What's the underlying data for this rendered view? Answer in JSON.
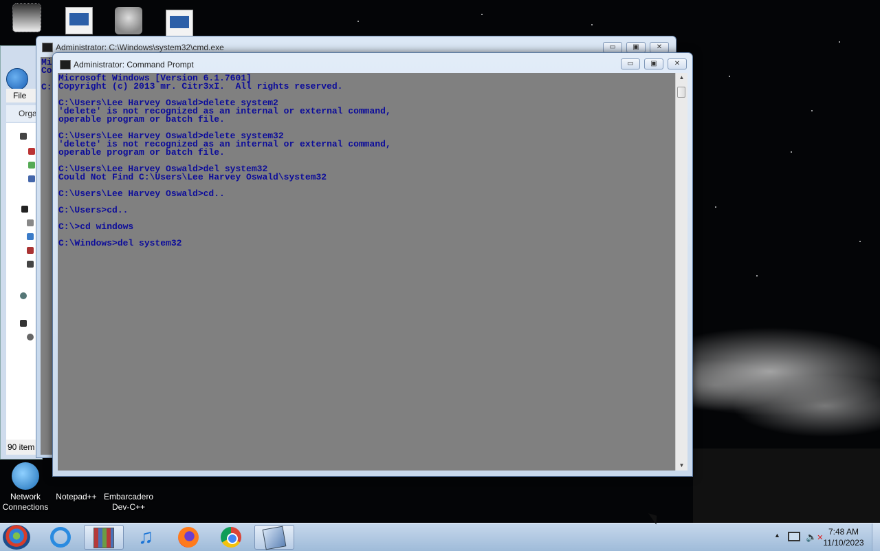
{
  "desktop": {
    "icons": [
      {
        "label": "Network Connections"
      },
      {
        "label": "Notepad++"
      },
      {
        "label": "Embarcadero Dev-C++"
      }
    ]
  },
  "explorer": {
    "menu_label": "File",
    "organize_label": "Orga",
    "status_text": "90 item"
  },
  "back_window": {
    "title": "Administrator: C:\\Windows\\system32\\cmd.exe",
    "visible_text_lines": [
      "Mi",
      "Co",
      "",
      "C:"
    ]
  },
  "front_window": {
    "title": "Administrator: Command Prompt",
    "minimize_glyph": "▭",
    "maximize_glyph": "▣",
    "close_glyph": "✕",
    "console_lines": [
      "Microsoft Windows [Version 6.1.7601]",
      "Copyright (c) 2013 mr. Citr3xI.  All rights reserved.",
      "",
      "C:\\Users\\Lee Harvey Oswald>delete system2",
      "'delete' is not recognized as an internal or external command,",
      "operable program or batch file.",
      "",
      "C:\\Users\\Lee Harvey Oswald>delete system32",
      "'delete' is not recognized as an internal or external command,",
      "operable program or batch file.",
      "",
      "C:\\Users\\Lee Harvey Oswald>del system32",
      "Could Not Find C:\\Users\\Lee Harvey Oswald\\system32",
      "",
      "C:\\Users\\Lee Harvey Oswald>cd..",
      "",
      "C:\\Users>cd..",
      "",
      "C:\\>cd windows",
      "",
      "C:\\Windows>del system32"
    ]
  },
  "taskbar": {
    "apps": [
      "start-icon",
      "internet-explorer-icon",
      "archive-icon",
      "music-icon",
      "firefox-icon",
      "chrome-icon",
      "cmd-icon"
    ],
    "clock_time": "7:48 AM",
    "clock_date": "11/10/2023",
    "tray_expand_glyph": "▲",
    "volume_muted_glyph": "✕"
  }
}
